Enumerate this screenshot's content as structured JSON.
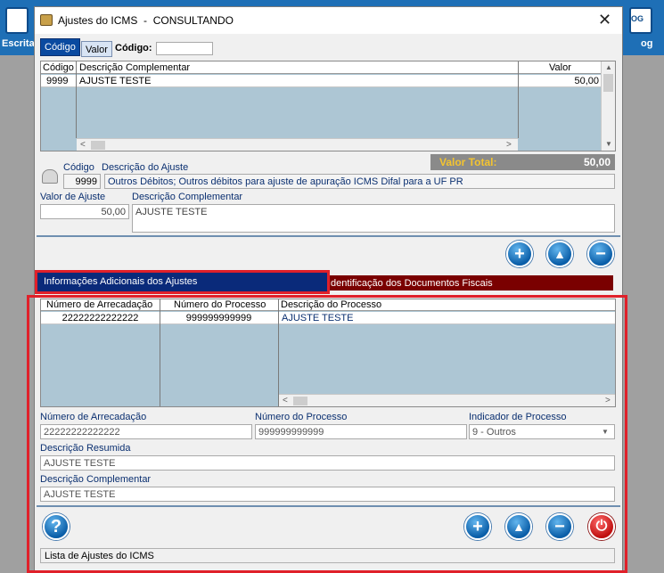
{
  "background_app": {
    "left_label": "Escrita",
    "right_label": "og",
    "right_icon_text": "OG"
  },
  "window": {
    "title": "Ajustes do ICMS",
    "mode": "CONSULTANDO",
    "title_separator": "-"
  },
  "search": {
    "tab_codigo": "Código",
    "tab_valor": "Valor",
    "codigo_label": "Código:",
    "codigo_value": ""
  },
  "top_grid": {
    "headers": [
      "Código",
      "Descrição Complementar",
      "Valor"
    ],
    "rows": [
      {
        "codigo": "9999",
        "descricao": "AJUSTE TESTE",
        "valor": "50,00"
      }
    ]
  },
  "total": {
    "label": "Valor Total:",
    "value": "50,00"
  },
  "detail": {
    "codigo_label": "Código",
    "descricao_label": "Descrição do Ajuste",
    "codigo_value": "9999",
    "descricao_value": "Outros Débitos; Outros débitos para ajuste de apuração ICMS Difal para a UF PR",
    "valor_label": "Valor de Ajuste",
    "valor_value": "50,00",
    "desc_comp_label": "Descrição Complementar",
    "desc_comp_value": "AJUSTE TESTE"
  },
  "tabs": {
    "info": "Informações Adicionais dos Ajustes",
    "id_docs": "Identificação dos Documentos Fiscais"
  },
  "info_grid": {
    "headers": [
      "Número de Arrecadação",
      "Número do Processo",
      "Descrição do Processo"
    ],
    "rows": [
      {
        "arrecadacao": "22222222222222",
        "processo": "999999999999",
        "descricao": "AJUSTE TESTE"
      }
    ]
  },
  "info_form": {
    "arrecadacao_label": "Número de Arrecadação",
    "arrecadacao_value": "22222222222222",
    "processo_label": "Número do Processo",
    "processo_value": "999999999999",
    "indicador_label": "Indicador de Processo",
    "indicador_value": "9 - Outros",
    "desc_resumida_label": "Descrição Resumida",
    "desc_resumida_value": "AJUSTE TESTE",
    "desc_comp_label": "Descrição Complementar",
    "desc_comp_value": "AJUSTE TESTE"
  },
  "status": {
    "text": "Lista de Ajustes do ICMS"
  },
  "icons": {
    "add": "+",
    "up": "▲",
    "remove": "−",
    "help": "?",
    "power": "⏻",
    "close": "✕",
    "scroll_left": "<",
    "scroll_right": ">",
    "scroll_up": "▲",
    "scroll_down": "▼"
  },
  "colors": {
    "total_bg": "#8a8a8a",
    "total_label": "#f4c430",
    "tab_active": "#0a2a7a",
    "tab_inactive": "#7a0000",
    "highlight": "#e0202a"
  }
}
